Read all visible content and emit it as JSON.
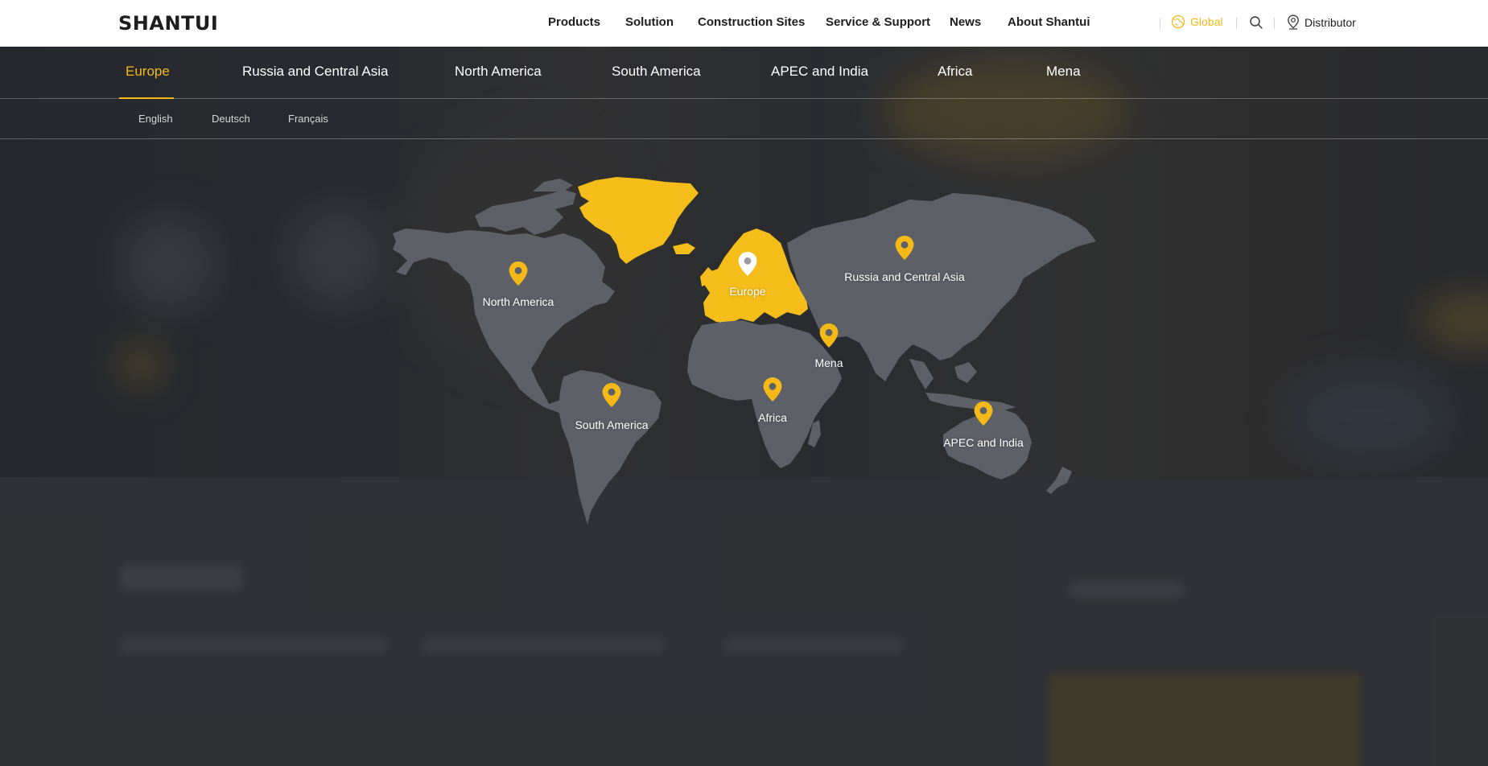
{
  "header": {
    "logo": "SHANTUI",
    "nav": [
      {
        "label": "Products"
      },
      {
        "label": "Solution"
      },
      {
        "label": "Construction Sites"
      },
      {
        "label": "Service & Support"
      },
      {
        "label": "News"
      },
      {
        "label": "About Shantui"
      }
    ],
    "global_label": "Global",
    "distributor_label": "Distributor",
    "icons": {
      "global": "globe-icon",
      "search": "search-icon",
      "distributor": "location-pin-icon"
    }
  },
  "region_tabs": [
    {
      "label": "Europe",
      "active": true
    },
    {
      "label": "Russia and Central Asia",
      "active": false
    },
    {
      "label": "North America",
      "active": false
    },
    {
      "label": "South America",
      "active": false
    },
    {
      "label": "APEC and India",
      "active": false
    },
    {
      "label": "Africa",
      "active": false
    },
    {
      "label": "Mena",
      "active": false
    }
  ],
  "languages": [
    "English",
    "Deutsch",
    "Français"
  ],
  "map": {
    "regions": [
      {
        "name": "europe",
        "label": "Europe",
        "selected": true
      },
      {
        "name": "russia-central-asia",
        "label": "Russia and Central Asia",
        "selected": false
      },
      {
        "name": "north-america",
        "label": "North America",
        "selected": false
      },
      {
        "name": "mena",
        "label": "Mena",
        "selected": false
      },
      {
        "name": "south-america",
        "label": "South America",
        "selected": false
      },
      {
        "name": "africa",
        "label": "Africa",
        "selected": false
      },
      {
        "name": "apec-india",
        "label": "APEC and India",
        "selected": false
      }
    ]
  },
  "colors": {
    "accent": "#f5b917",
    "land": "#5e6068",
    "highlight": "#f5bd1a",
    "pin_selected": "#ffffff",
    "text_dark": "#1e1e1e"
  }
}
